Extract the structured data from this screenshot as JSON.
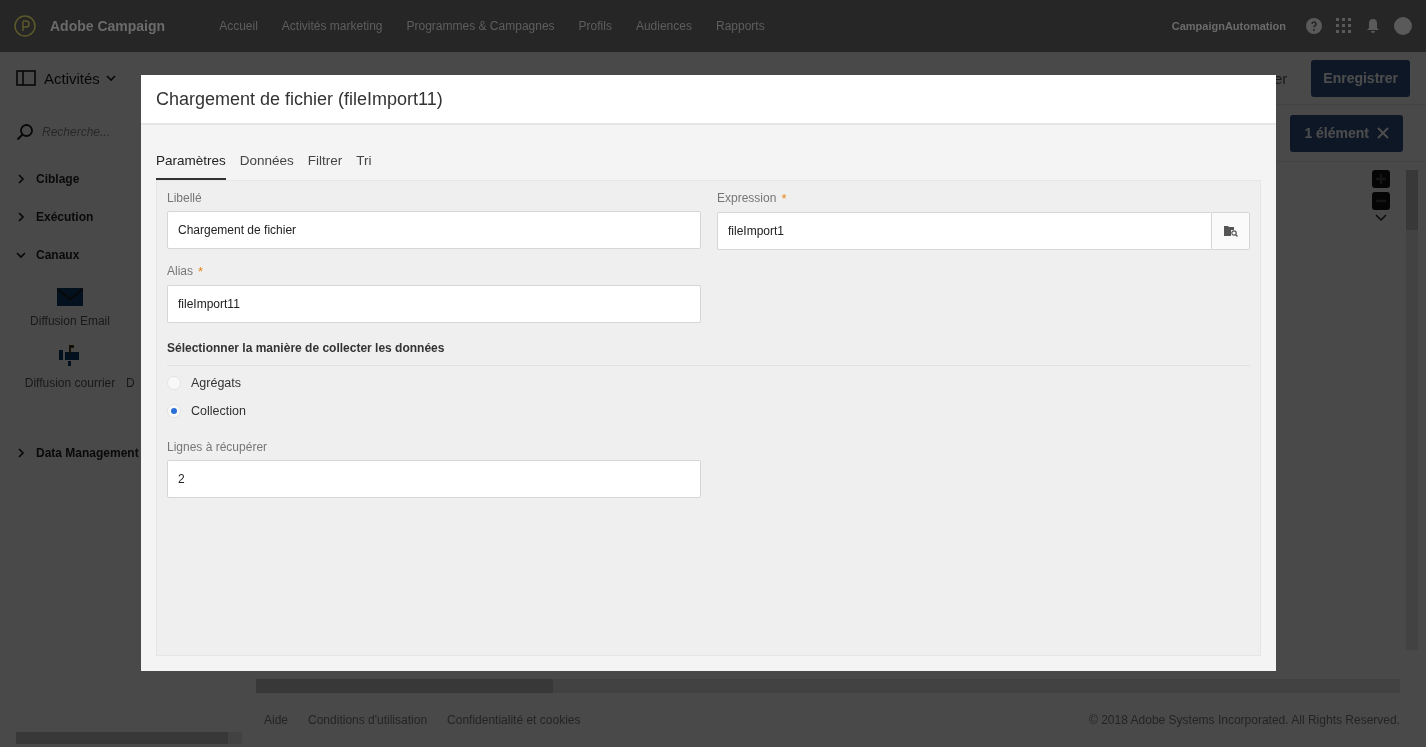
{
  "topbar": {
    "brand": "Adobe Campaign",
    "nav": [
      {
        "label": "Accueil"
      },
      {
        "label": "Activités marketing"
      },
      {
        "label": "Programmes & Campagnes"
      },
      {
        "label": "Profils"
      },
      {
        "label": "Audiences"
      },
      {
        "label": "Rapports"
      }
    ],
    "user": "CampaignAutomation"
  },
  "sidebar": {
    "title": "Activités",
    "search": {
      "placeholder": "Recherche..."
    },
    "groups": [
      {
        "label": "Ciblage",
        "expanded": false
      },
      {
        "label": "Exécution",
        "expanded": false
      },
      {
        "label": "Canaux",
        "expanded": true,
        "children": [
          {
            "label": "Diffusion Email",
            "kind": "email"
          },
          {
            "label": "Diffusion courrier",
            "kind": "mail"
          },
          {
            "label": "D",
            "kind": "partial"
          }
        ]
      },
      {
        "label": "Data Management",
        "expanded": false
      }
    ]
  },
  "toolbar": {
    "partial_label": "er",
    "save_button": "Enregistrer",
    "selection_badge": "1 élément"
  },
  "footer": {
    "links": [
      {
        "label": "Aide"
      },
      {
        "label": "Conditions d'utilisation"
      },
      {
        "label": "Confidentialité et cookies"
      }
    ],
    "copyright": "© 2018 Adobe Systems Incorporated. All Rights Reserved."
  },
  "dialog": {
    "title": "Chargement de fichier (fileImport11)",
    "tabs": [
      {
        "label": "Paramètres",
        "selected": true
      },
      {
        "label": "Données",
        "selected": false
      },
      {
        "label": "Filtrer",
        "selected": false
      },
      {
        "label": "Tri",
        "selected": false
      }
    ],
    "libelle": {
      "label": "Libellé",
      "value": "Chargement de fichier"
    },
    "expression": {
      "label": "Expression",
      "required_mark": "*",
      "value": "fileImport1"
    },
    "alias": {
      "label": "Alias",
      "required_mark": "*",
      "value": "fileImport11"
    },
    "section_title": "Sélectionner la manière de collecter les données",
    "options": [
      {
        "label": "Agrégats",
        "selected": false
      },
      {
        "label": "Collection",
        "selected": true
      }
    ],
    "rows_field": {
      "label": "Lignes à récupérer",
      "value": "2"
    }
  }
}
